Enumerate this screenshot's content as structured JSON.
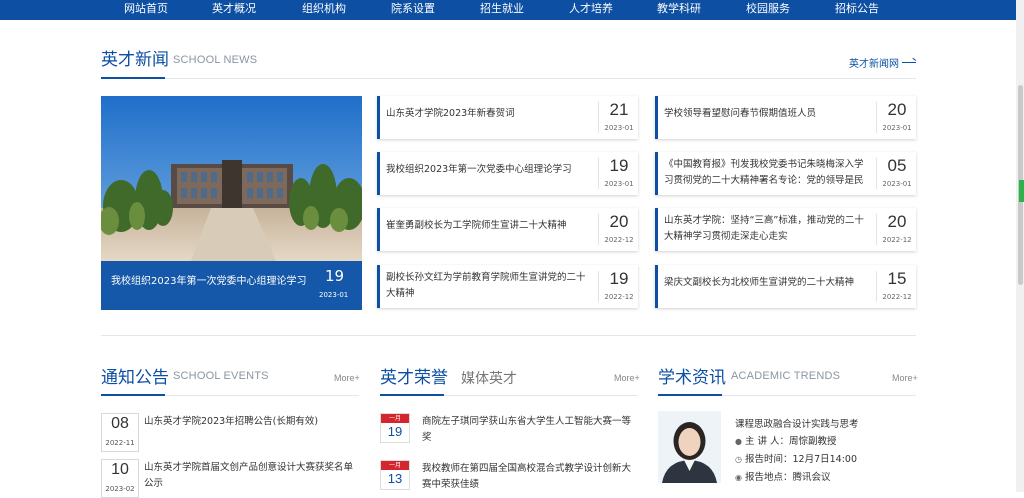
{
  "nav": [
    "网站首页",
    "英才概况",
    "组织机构",
    "院系设置",
    "招生就业",
    "人才培养",
    "教学科研",
    "校园服务",
    "招标公告"
  ],
  "news_section": {
    "title": "英才新闻",
    "subtitle": "SCHOOL NEWS",
    "more_label": "英才新闻网"
  },
  "featured": {
    "title": "我校组织2023年第一次党委中心组理论学习",
    "day": "19",
    "ym": "2023-01"
  },
  "news": [
    {
      "text": "山东英才学院2023年新春贺词",
      "day": "21",
      "ym": "2023-01"
    },
    {
      "text": "学校领导看望慰问春节假期值班人员",
      "day": "20",
      "ym": "2023-01"
    },
    {
      "text": "我校组织2023年第一次党委中心组理论学习",
      "day": "19",
      "ym": "2023-01"
    },
    {
      "text": "《中国教育报》刊发我校党委书记朱晓梅深入学习贯彻党的二十大精神署名专论：党的领导是民",
      "day": "05",
      "ym": "2023-01"
    },
    {
      "text": "崔奎勇副校长为工学院师生宣讲二十大精神",
      "day": "20",
      "ym": "2022-12"
    },
    {
      "text": "山东英才学院：坚持“三高”标准，推动党的二十大精神学习贯彻走深走心走实",
      "day": "20",
      "ym": "2022-12"
    },
    {
      "text": "副校长孙文红为学前教育学院师生宣讲党的二十大精神",
      "day": "19",
      "ym": "2022-12"
    },
    {
      "text": "梁庆文副校长为北校师生宣讲党的二十大精神",
      "day": "15",
      "ym": "2022-12"
    }
  ],
  "notice": {
    "title": "通知公告",
    "subtitle": "SCHOOL EVENTS",
    "more": "More+",
    "items": [
      {
        "day": "08",
        "ym": "2022-11",
        "text": "山东英才学院2023年招聘公告(长期有效)"
      },
      {
        "day": "10",
        "ym": "2023-02",
        "text": "山东英才学院首届文创产品创意设计大赛获奖名单公示"
      }
    ]
  },
  "honor": {
    "title": "英才荣誉",
    "tab2": "媒体英才",
    "more": "More+",
    "items": [
      {
        "month": "一月",
        "day": "19",
        "text": "商院左子琪同学获山东省大学生人工智能大赛一等奖"
      },
      {
        "month": "一月",
        "day": "13",
        "text": "我校教师在第四届全国高校混合式教学设计创新大赛中荣获佳绩"
      }
    ]
  },
  "academic": {
    "title": "学术资讯",
    "subtitle": "ACADEMIC TRENDS",
    "more": "More+",
    "item": {
      "title": "课程思政融合设计实践与思考",
      "speaker": "主 讲 人：周悰副教授",
      "time": "报告时间：12月7日14:00",
      "place": "报告地点：腾讯会议"
    }
  },
  "colors": {
    "primary": "#0d4fa3",
    "calendar_red": "#d6262d"
  }
}
